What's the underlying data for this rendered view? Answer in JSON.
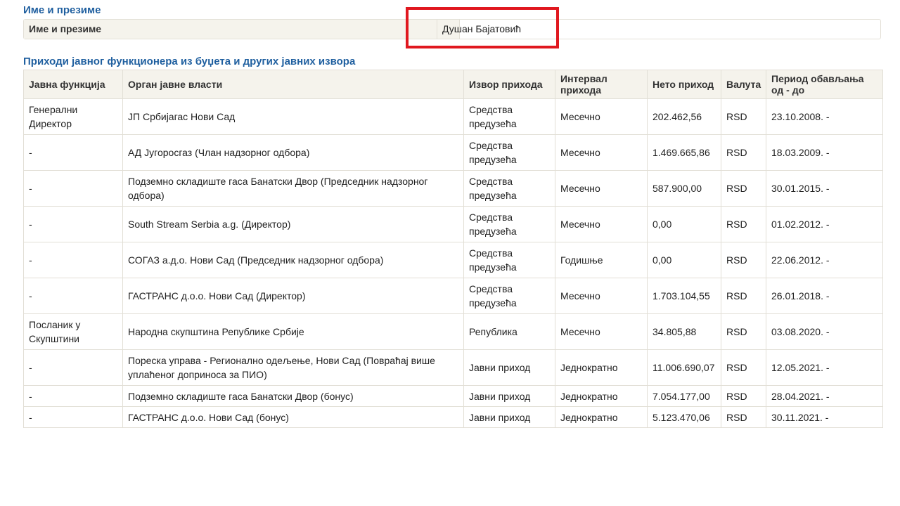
{
  "name_section": {
    "title": "Име и презиме",
    "label": "Име и презиме",
    "value": "Душан Бајатовић"
  },
  "income_section": {
    "title": "Приходи јавног функционера из буџета и других јавних извора",
    "columns": [
      "Јавна функција",
      "Орган јавне власти",
      "Извор прихода",
      "Интервал прихода",
      "Нето приход",
      "Валута",
      "Период обављања од - до"
    ],
    "rows": [
      {
        "function": "Генерални Директор",
        "authority": "ЈП Србијагас Нови Сад",
        "source": "Средства предузећа",
        "interval": "Месечно",
        "net": "202.462,56",
        "currency": "RSD",
        "period": "23.10.2008. -"
      },
      {
        "function": "-",
        "authority": "АД Југоросгаз (Члан надзорног одбора)",
        "source": "Средства предузећа",
        "interval": "Месечно",
        "net": "1.469.665,86",
        "currency": "RSD",
        "period": "18.03.2009. -"
      },
      {
        "function": "-",
        "authority": "Подземно складиште гаса Банатски Двор (Председник надзорног одбора)",
        "source": "Средства предузећа",
        "interval": "Месечно",
        "net": "587.900,00",
        "currency": "RSD",
        "period": "30.01.2015. -"
      },
      {
        "function": "-",
        "authority": "South Stream Serbia a.g. (Директор)",
        "source": "Средства предузећа",
        "interval": "Месечно",
        "net": "0,00",
        "currency": "RSD",
        "period": "01.02.2012. -"
      },
      {
        "function": "-",
        "authority": "СОГАЗ а.д.о. Нови Сад (Председник надзорног одбора)",
        "source": "Средства предузећа",
        "interval": "Годишње",
        "net": "0,00",
        "currency": "RSD",
        "period": "22.06.2012. -"
      },
      {
        "function": "-",
        "authority": "ГАСТРАНС д.о.о. Нови Сад (Директор)",
        "source": "Средства предузећа",
        "interval": "Месечно",
        "net": "1.703.104,55",
        "currency": "RSD",
        "period": "26.01.2018. -"
      },
      {
        "function": "Посланик у Скупштини",
        "authority": "Народна скупштина Републике Србије",
        "source": "Република",
        "interval": "Месечно",
        "net": "34.805,88",
        "currency": "RSD",
        "period": "03.08.2020. -"
      },
      {
        "function": "-",
        "authority": "Пореска управа - Регионално одељење, Нови Сад (Повраћај више уплаћеног доприноса за ПИО)",
        "source": "Јавни приход",
        "interval": "Једнократно",
        "net": "11.006.690,07",
        "currency": "RSD",
        "period": "12.05.2021. -"
      },
      {
        "function": "-",
        "authority": "Подземно складиште гаса Банатски Двор (бонус)",
        "source": "Јавни приход",
        "interval": "Једнократно",
        "net": "7.054.177,00",
        "currency": "RSD",
        "period": "28.04.2021. -"
      },
      {
        "function": "-",
        "authority": "ГАСТРАНС д.о.о. Нови Сад (бонус)",
        "source": "Јавни приход",
        "interval": "Једнократно",
        "net": "5.123.470,06",
        "currency": "RSD",
        "period": "30.11.2021. -"
      }
    ]
  },
  "colors": {
    "section_title": "#1f5f9f",
    "header_bg": "#f5f3ec",
    "border": "#e2dfd6",
    "highlight": "#e0181f"
  }
}
